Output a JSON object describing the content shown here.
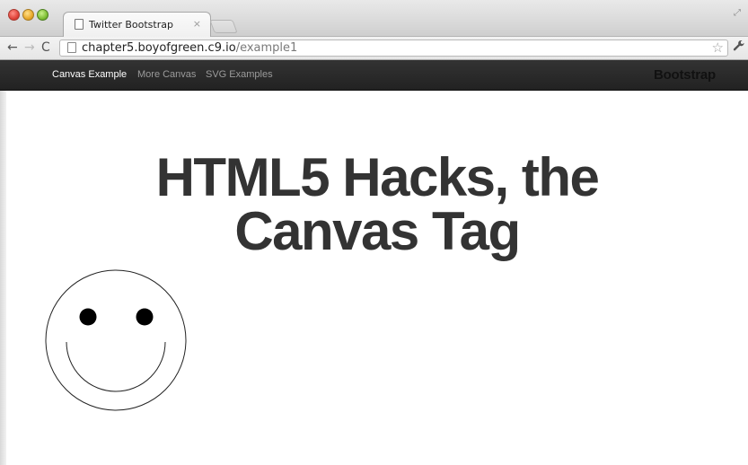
{
  "browser": {
    "tab_title": "Twitter Bootstrap",
    "tab_close": "×",
    "url_host": "chapter5.boyofgreen.c9.io",
    "url_path": "/example1",
    "back_glyph": "←",
    "forward_glyph": "→",
    "reload_glyph": "C",
    "star_glyph": "☆",
    "wrench_glyph": "🔧",
    "fullscreen_glyph": "⤢"
  },
  "navbar": {
    "items": [
      {
        "label": "Canvas Example",
        "active": true
      },
      {
        "label": "More Canvas",
        "active": false
      },
      {
        "label": "SVG Examples",
        "active": false
      }
    ],
    "brand": "Bootstrap"
  },
  "hero": {
    "title_line1": "HTML5 Hacks, the",
    "title_line2": "Canvas Tag"
  },
  "colors": {
    "navbar_bg": "#222222",
    "nav_active": "#ffffff",
    "nav_inactive": "#9b9b9b",
    "heading": "#333333"
  }
}
